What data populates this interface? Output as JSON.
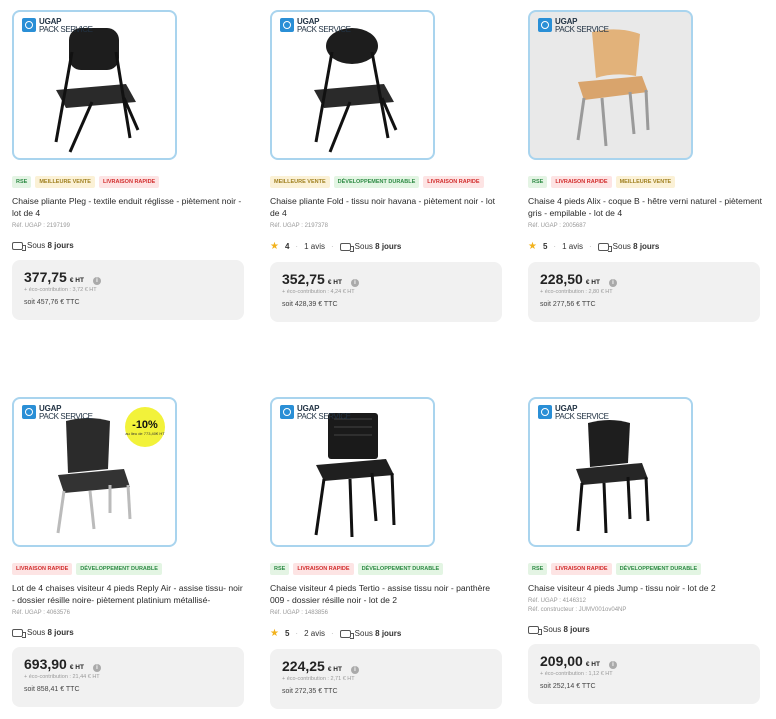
{
  "brand": {
    "name": "UGAP",
    "sub": "PACK SERVICE"
  },
  "badge_labels": {
    "rse": "RSE",
    "best": "MEILLEURE VENTE",
    "fast": "LIVRAISON RAPIDE",
    "dev": "DÉVELOPPEMENT DURABLE"
  },
  "colors": {
    "accent": "#2a8fd6",
    "card_border": "#a9d4ee",
    "star": "#f2b21d",
    "price_bg": "#f1f1f1"
  },
  "products": [
    {
      "title": "Chaise pliante Pleg - textile enduit réglisse - piètement noir - lot de 4",
      "ref": "Réf. UGAP : 2197199",
      "delivery_prefix": "Sous",
      "delivery_days": "8 jours",
      "price": "377,75",
      "ht": "€ HT",
      "eco": "+ éco-contribution : 3,72 € HT",
      "ttc": "soit 457,76 € TTC",
      "badges": [
        "RSE",
        "MEILLEURE VENTE",
        "LIVRAISON RAPIDE"
      ]
    },
    {
      "title": "Chaise pliante Fold - tissu noir havana - piètement noir - lot de 4",
      "ref": "Réf. UGAP : 2197378",
      "rating": "4",
      "reviews": "1 avis",
      "delivery_prefix": "Sous",
      "delivery_days": "8 jours",
      "price": "352,75",
      "ht": "€ HT",
      "eco": "+ éco-contribution : 4,24 € HT",
      "ttc": "soit 428,39 € TTC",
      "badges": [
        "MEILLEURE VENTE",
        "DÉVELOPPEMENT DURABLE",
        "LIVRAISON RAPIDE"
      ]
    },
    {
      "title": "Chaise 4 pieds Alix - coque B - hêtre verni naturel - piètement gris - empilable - lot de 4",
      "ref": "Réf. UGAP : 2005687",
      "rating": "5",
      "reviews": "1 avis",
      "delivery_prefix": "Sous",
      "delivery_days": "8 jours",
      "price": "228,50",
      "ht": "€ HT",
      "eco": "+ éco-contribution : 2,80 € HT",
      "ttc": "soit 277,56 € TTC",
      "badges": [
        "RSE",
        "LIVRAISON RAPIDE",
        "MEILLEURE VENTE"
      ]
    },
    {
      "title": "Lot de 4 chaises visiteur 4 pieds Reply Air - assise tissu- noir - dossier résille noire- piètement platinium métallisé-",
      "ref": "Réf. UGAP : 4063576",
      "delivery_prefix": "Sous",
      "delivery_days": "8 jours",
      "price": "693,90",
      "ht": "€ HT",
      "eco": "+ éco-contribution : 21,44 € HT",
      "ttc": "soit 858,41 € TTC",
      "promo_pct": "-10%",
      "promo_small": "au lieu de 773,40€ HT",
      "badges": [
        "LIVRAISON RAPIDE",
        "DÉVELOPPEMENT DURABLE"
      ]
    },
    {
      "title": "Chaise visiteur 4 pieds Tertio - assise tissu noir - panthère 009 - dossier résille noir - lot de 2",
      "ref": "Réf. UGAP : 1483856",
      "rating": "5",
      "reviews": "2 avis",
      "delivery_prefix": "Sous",
      "delivery_days": "8 jours",
      "price": "224,25",
      "ht": "€ HT",
      "eco": "+ éco-contribution : 2,71 € HT",
      "ttc": "soit 272,35 € TTC",
      "badges": [
        "RSE",
        "LIVRAISON RAPIDE",
        "DÉVELOPPEMENT DURABLE"
      ]
    },
    {
      "title": "Chaise visiteur 4 pieds Jump - tissu noir - lot de 2",
      "ref": "Réf. UGAP : 4146312",
      "ref2": "Réf. constructeur : JUMV001ov04NP",
      "delivery_prefix": "Sous",
      "delivery_days": "8 jours",
      "price": "209,00",
      "ht": "€ HT",
      "eco": "+ éco-contribution : 1,12 € HT",
      "ttc": "soit 252,14 € TTC",
      "badges": [
        "RSE",
        "LIVRAISON RAPIDE",
        "DÉVELOPPEMENT DURABLE"
      ]
    }
  ]
}
